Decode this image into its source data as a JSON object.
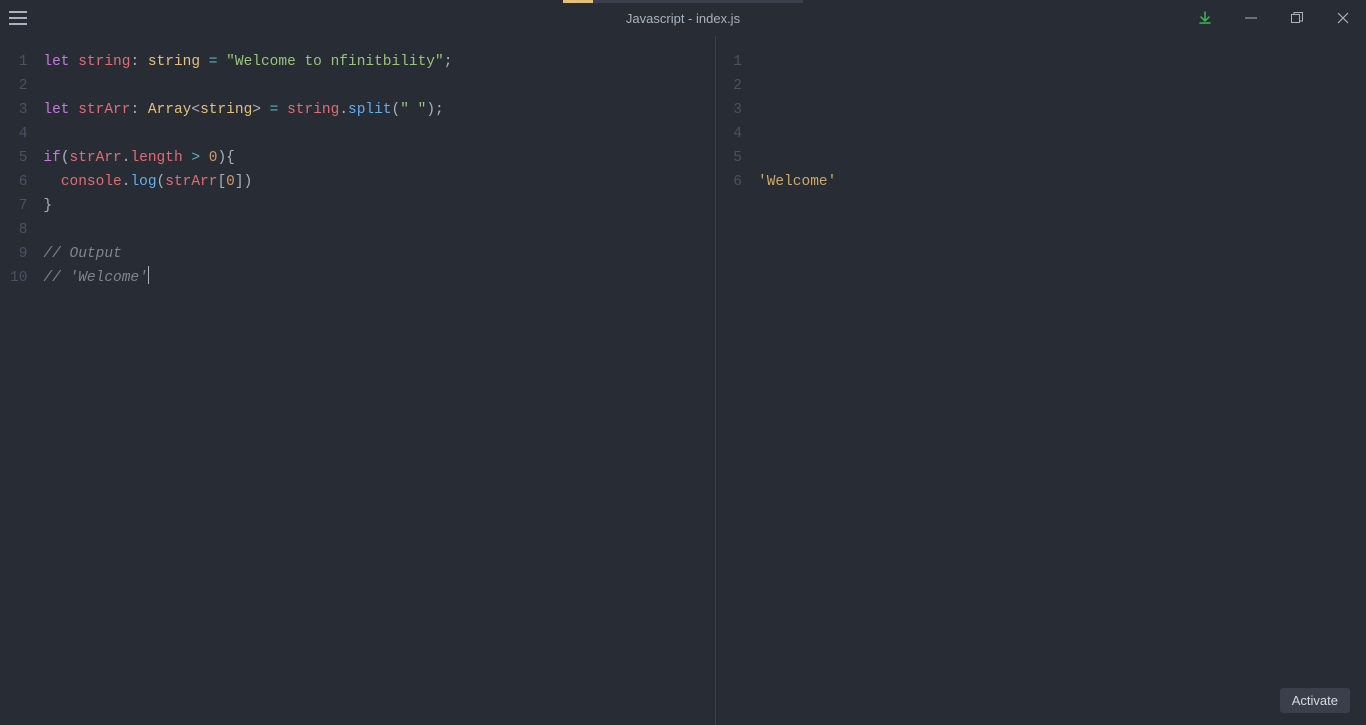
{
  "window": {
    "title": "Javascript - index.js"
  },
  "buttons": {
    "activate": "Activate"
  },
  "leftPane": {
    "lineNumbers": [
      "1",
      "2",
      "3",
      "4",
      "5",
      "6",
      "7",
      "8",
      "9",
      "10"
    ],
    "code": {
      "l1": {
        "let": "let",
        "var1": "string",
        "colon": ": ",
        "type": "string",
        "eq": " = ",
        "str": "\"Welcome to nfinitbility\"",
        "semi": ";"
      },
      "l3": {
        "let": "let",
        "var1": "strArr",
        "colon": ": ",
        "arr": "Array",
        "lt": "<",
        "typ": "string",
        "gt": ">",
        "eq": " = ",
        "v2": "string",
        "dot": ".",
        "fn": "split",
        "p1": "(",
        "arg": "\" \"",
        "p2": ");"
      },
      "l5": {
        "if": "if",
        "p1": "(",
        "v": "strArr",
        "dot": ".",
        "prop": "length",
        "op": " > ",
        "num": "0",
        "p2": "){"
      },
      "l6": {
        "indent": "  ",
        "obj": "console",
        "dot": ".",
        "fn": "log",
        "p1": "(",
        "v": "strArr",
        "b1": "[",
        "num": "0",
        "b2": "])"
      },
      "l7": {
        "brace": "}"
      },
      "l9": {
        "cmt": "// Output"
      },
      "l10": {
        "cmt": "// 'Welcome'"
      }
    }
  },
  "rightPane": {
    "lineNumbers": [
      "1",
      "2",
      "3",
      "4",
      "5",
      "6"
    ],
    "outputLine": 6,
    "output": "'Welcome'"
  }
}
